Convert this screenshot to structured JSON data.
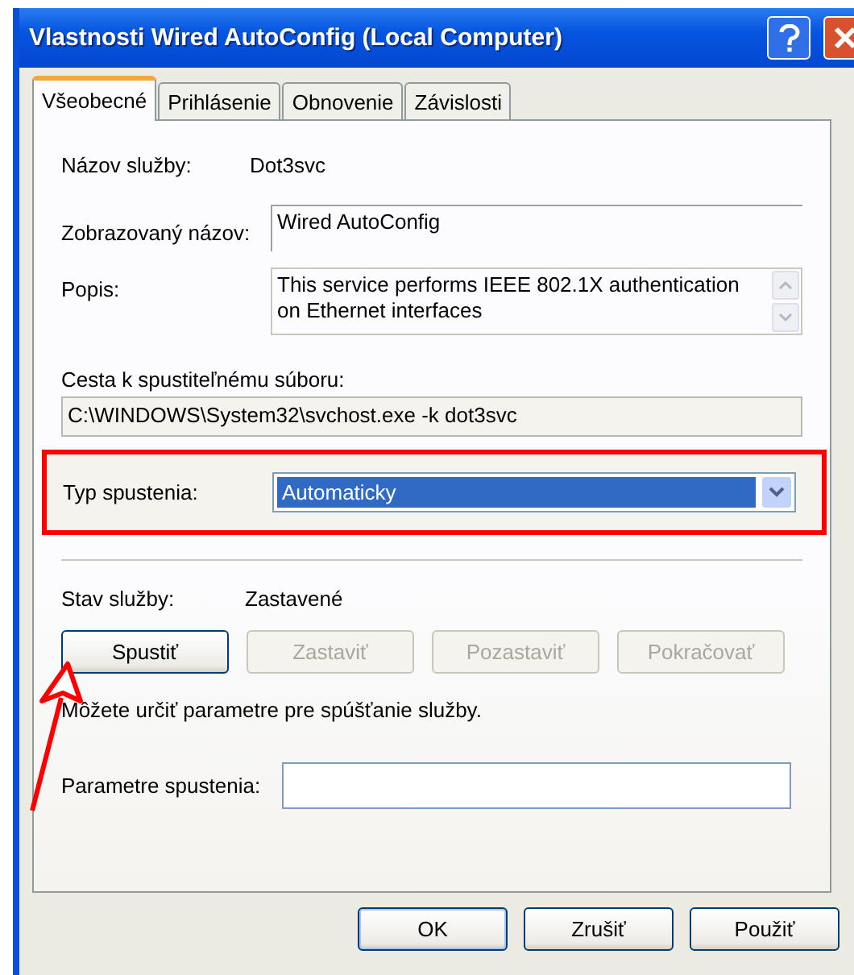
{
  "window": {
    "title": "Vlastnosti Wired AutoConfig (Local Computer)"
  },
  "tabs": [
    {
      "label": "Všeobecné",
      "selected": true
    },
    {
      "label": "Prihlásenie",
      "selected": false
    },
    {
      "label": "Obnovenie",
      "selected": false
    },
    {
      "label": "Závislosti",
      "selected": false
    }
  ],
  "service_name": {
    "label": "Názov služby:",
    "value": "Dot3svc"
  },
  "display_name": {
    "label": "Zobrazovaný názov:",
    "value": "Wired AutoConfig"
  },
  "description": {
    "label": "Popis:",
    "value": "This service performs IEEE 802.1X authentication on Ethernet interfaces"
  },
  "executable_path": {
    "label": "Cesta k spustiteľnému súboru:",
    "value": "C:\\WINDOWS\\System32\\svchost.exe -k dot3svc"
  },
  "startup_type": {
    "label": "Typ spustenia:",
    "value": "Automaticky",
    "highlighted": true
  },
  "service_status": {
    "label": "Stav služby:",
    "value": "Zastavené"
  },
  "service_buttons": [
    {
      "label": "Spustiť",
      "disabled": false
    },
    {
      "label": "Zastaviť",
      "disabled": true
    },
    {
      "label": "Pozastaviť",
      "disabled": true
    },
    {
      "label": "Pokračovať",
      "disabled": true
    }
  ],
  "hint": "Môžete určiť parametre pre spúšťanie služby.",
  "start_parameters": {
    "label": "Parametre spustenia:"
  },
  "dialog_buttons": [
    {
      "label": "OK",
      "default": true
    },
    {
      "label": "Zrušiť",
      "default": false
    },
    {
      "label": "Použiť",
      "default": false
    }
  ],
  "annotation": {
    "arrow": true
  }
}
